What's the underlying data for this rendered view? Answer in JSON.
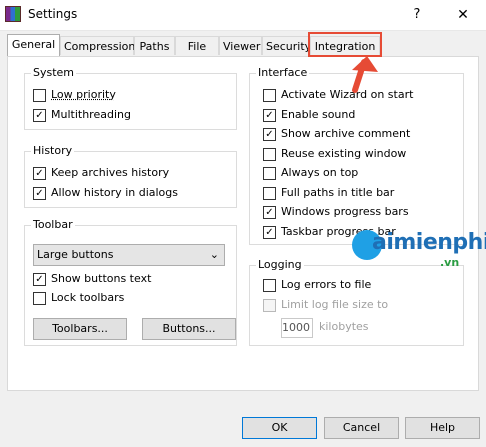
{
  "window": {
    "title": "Settings",
    "help": "?",
    "close": "✕"
  },
  "tabs": [
    "General",
    "Compression",
    "Paths",
    "File list",
    "Viewer",
    "Security",
    "Integration"
  ],
  "system": {
    "title": "System",
    "items": [
      {
        "label": "Low priority",
        "checked": false
      },
      {
        "label": "Multithreading",
        "checked": true
      }
    ]
  },
  "history": {
    "title": "History",
    "items": [
      {
        "label": "Keep archives history",
        "checked": true
      },
      {
        "label": "Allow history in dialogs",
        "checked": true
      }
    ]
  },
  "toolbar": {
    "title": "Toolbar",
    "select_value": "Large buttons",
    "items": [
      {
        "label": "Show buttons text",
        "checked": true
      },
      {
        "label": "Lock toolbars",
        "checked": false
      }
    ],
    "toolbars_button": "Toolbars...",
    "buttons_button": "Buttons..."
  },
  "interface": {
    "title": "Interface",
    "items": [
      {
        "label": "Activate Wizard on start",
        "checked": false
      },
      {
        "label": "Enable sound",
        "checked": true
      },
      {
        "label": "Show archive comment",
        "checked": true
      },
      {
        "label": "Reuse existing window",
        "checked": false
      },
      {
        "label": "Always on top",
        "checked": false
      },
      {
        "label": "Full paths in title bar",
        "checked": false
      },
      {
        "label": "Windows progress bars",
        "checked": true
      },
      {
        "label": "Taskbar progress bar",
        "checked": true
      }
    ]
  },
  "logging": {
    "title": "Logging",
    "items": [
      {
        "label": "Log errors to file",
        "checked": false
      },
      {
        "label": "Limit log file size to",
        "checked": false,
        "disabled": true
      }
    ],
    "size_value": "1000",
    "size_units": "kilobytes"
  },
  "footer": {
    "ok": "OK",
    "cancel": "Cancel",
    "help": "Help"
  },
  "watermark": {
    "text": "aimienphi",
    "suffix": ".vn"
  },
  "colors": {
    "highlight": "#e64b35",
    "accent": "#0078d7"
  }
}
